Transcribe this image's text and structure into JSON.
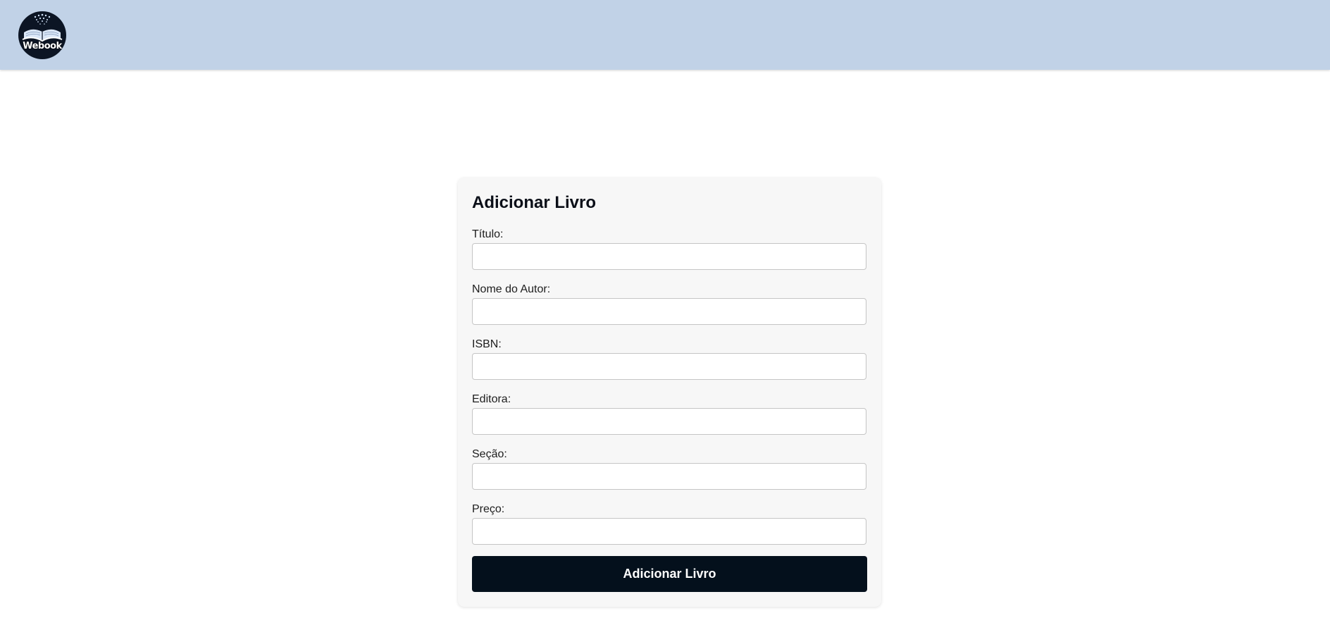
{
  "header": {
    "logo_text": "Webook",
    "logo_icon": "open-book-icon",
    "background_color": "#c1d2e7"
  },
  "form": {
    "title": "Adicionar Livro",
    "fields": [
      {
        "label": "Título:",
        "value": "",
        "placeholder": ""
      },
      {
        "label": "Nome do Autor:",
        "value": "",
        "placeholder": ""
      },
      {
        "label": "ISBN:",
        "value": "",
        "placeholder": ""
      },
      {
        "label": "Editora:",
        "value": "",
        "placeholder": ""
      },
      {
        "label": "Seção:",
        "value": "",
        "placeholder": ""
      },
      {
        "label": "Preço:",
        "value": "",
        "placeholder": ""
      }
    ],
    "submit_label": "Adicionar Livro",
    "submit_color": "#04101c"
  }
}
